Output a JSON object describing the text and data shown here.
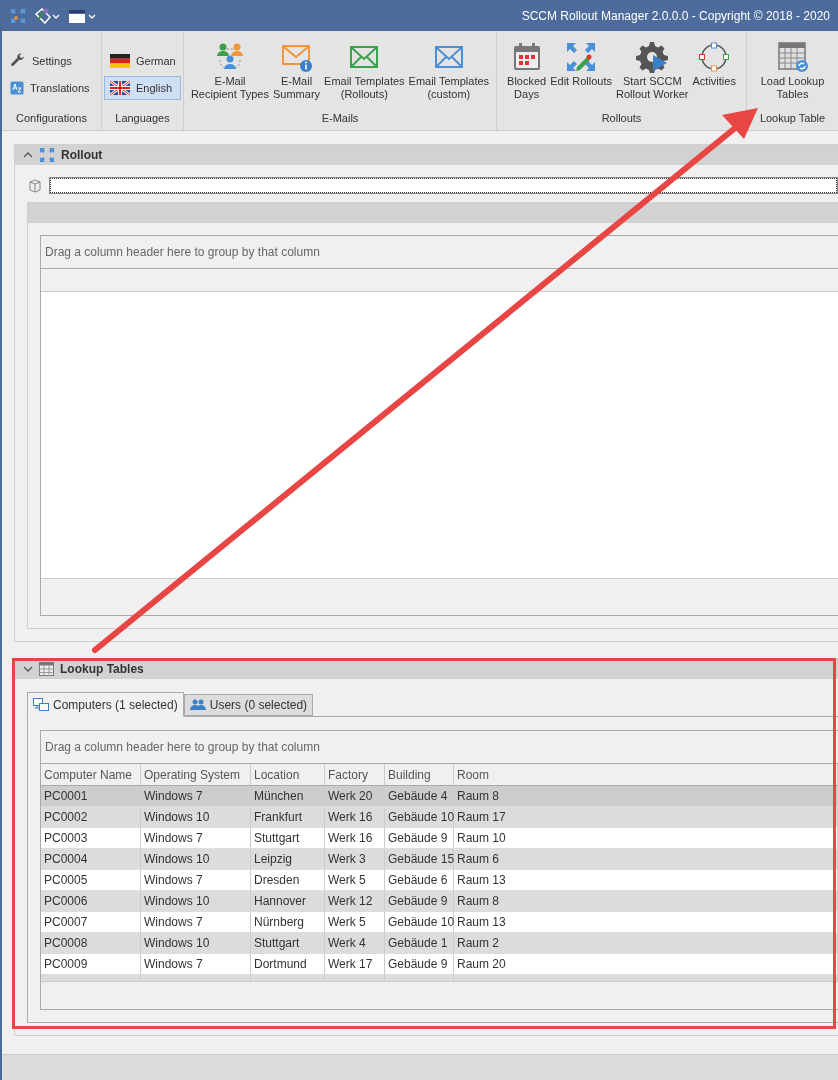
{
  "window": {
    "title": "SCCM Rollout Manager 2.0.0.0 - Copyright © 2018 - 2020"
  },
  "ribbon": {
    "groups": [
      {
        "label": "Configurations",
        "items": [
          {
            "label": "Settings",
            "kind": "small",
            "selected": false
          },
          {
            "label": "Translations",
            "kind": "small",
            "selected": false
          }
        ]
      },
      {
        "label": "Languages",
        "items": [
          {
            "label": "German",
            "kind": "small",
            "selected": false
          },
          {
            "label": "English",
            "kind": "small",
            "selected": true
          }
        ]
      },
      {
        "label": "E-Mails",
        "items": [
          {
            "label": "E-Mail\nRecipient Types",
            "kind": "large",
            "selected": false
          },
          {
            "label": "E-Mail\nSummary",
            "kind": "large",
            "selected": false
          },
          {
            "label": "Email Templates\n(Rollouts)",
            "kind": "large",
            "selected": false
          },
          {
            "label": "Email Templates\n(custom)",
            "kind": "large",
            "selected": false
          }
        ]
      },
      {
        "label": "Rollouts",
        "items": [
          {
            "label": "Blocked\nDays",
            "kind": "large",
            "selected": false
          },
          {
            "label": "Edit Rollouts",
            "kind": "large",
            "selected": false
          },
          {
            "label": "Start SCCM\nRollout Worker",
            "kind": "large",
            "selected": false
          },
          {
            "label": "Activities",
            "kind": "large",
            "selected": false
          }
        ]
      },
      {
        "label": "Lookup Table",
        "items": [
          {
            "label": "Load Lookup\nTables",
            "kind": "large",
            "selected": false
          }
        ]
      }
    ]
  },
  "rollout_panel": {
    "title": "Rollout",
    "group_hint": "Drag a column header here to group by that column"
  },
  "lookup_panel": {
    "title": "Lookup Tables",
    "tabs": [
      {
        "label": "Computers (1 selected)",
        "selected": true
      },
      {
        "label": "Users (0 selected)",
        "selected": false
      }
    ],
    "group_hint": "Drag a column header here to group by that column",
    "columns": [
      "Computer Name",
      "Operating System",
      "Location",
      "Factory",
      "Building",
      "Room"
    ],
    "rows": [
      {
        "cells": [
          "PC0001",
          "Windows 7",
          "München",
          "Werk 20",
          "Gebäude 4",
          "Raum 8"
        ],
        "selected": true
      },
      {
        "cells": [
          "PC0002",
          "Windows 10",
          "Frankfurt",
          "Werk 16",
          "Gebäude 10",
          "Raum 17"
        ],
        "selected": false
      },
      {
        "cells": [
          "PC0003",
          "Windows 7",
          "Stuttgart",
          "Werk 16",
          "Gebäude 9",
          "Raum 10"
        ],
        "selected": false
      },
      {
        "cells": [
          "PC0004",
          "Windows 10",
          "Leipzig",
          "Werk 3",
          "Gebäude 15",
          "Raum 6"
        ],
        "selected": false
      },
      {
        "cells": [
          "PC0005",
          "Windows 7",
          "Dresden",
          "Werk 5",
          "Gebäude 6",
          "Raum 13"
        ],
        "selected": false
      },
      {
        "cells": [
          "PC0006",
          "Windows 10",
          "Hannover",
          "Werk 12",
          "Gebäude 9",
          "Raum 8"
        ],
        "selected": false
      },
      {
        "cells": [
          "PC0007",
          "Windows 7",
          "Nürnberg",
          "Werk 5",
          "Gebäude 10",
          "Raum 13"
        ],
        "selected": false
      },
      {
        "cells": [
          "PC0008",
          "Windows 10",
          "Stuttgart",
          "Werk 4",
          "Gebäude 1",
          "Raum 2"
        ],
        "selected": false
      },
      {
        "cells": [
          "PC0009",
          "Windows 7",
          "Dortmund",
          "Werk 17",
          "Gebäude 9",
          "Raum 20"
        ],
        "selected": false
      }
    ]
  }
}
